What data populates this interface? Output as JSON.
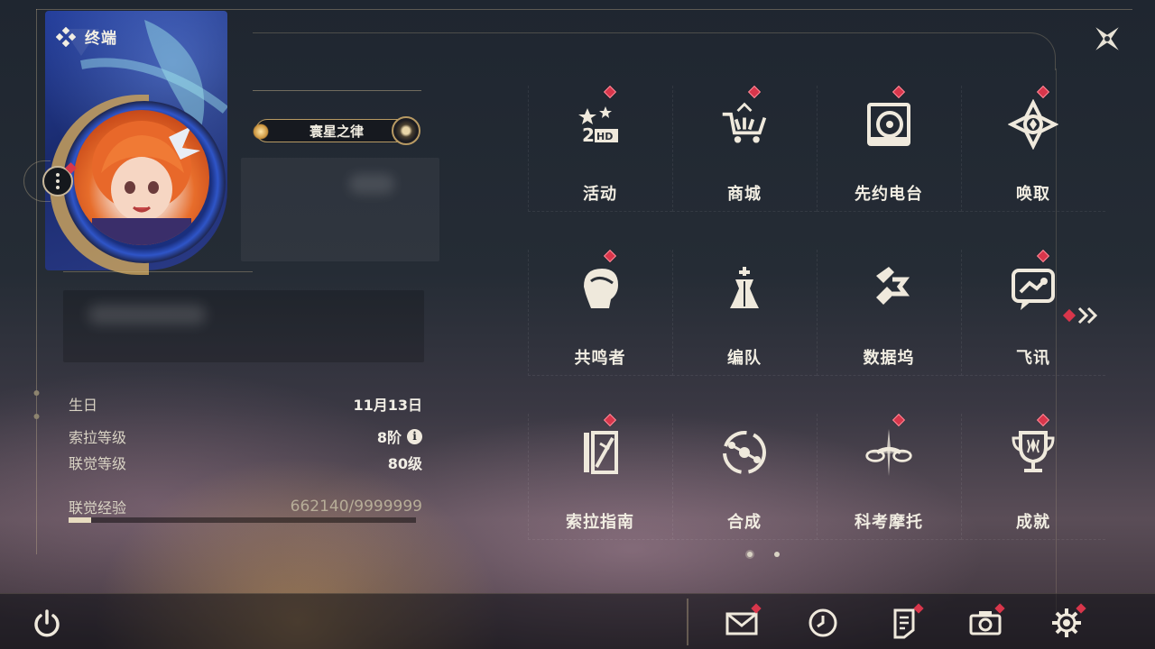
{
  "header": {
    "title": "终端"
  },
  "profile": {
    "title_badge": "寰星之律",
    "stats": [
      {
        "label": "生日",
        "value": "11月13日"
      },
      {
        "label": "索拉等级",
        "value": "8阶"
      },
      {
        "label": "联觉等级",
        "value": "80级"
      }
    ],
    "exp": {
      "label": "联觉经验",
      "value": "662140/9999999",
      "progress_fraction": 0.066
    }
  },
  "menu": {
    "items": [
      {
        "label": "活动",
        "icon": "event-2hd-icon",
        "badge": true
      },
      {
        "label": "商城",
        "icon": "shop-cart-icon",
        "badge": true
      },
      {
        "label": "先约电台",
        "icon": "radio-icon",
        "badge": true
      },
      {
        "label": "唤取",
        "icon": "summon-icon",
        "badge": true
      },
      {
        "label": "共鸣者",
        "icon": "resonator-icon",
        "badge": true
      },
      {
        "label": "编队",
        "icon": "team-chess-icon",
        "badge": false
      },
      {
        "label": "数据坞",
        "icon": "data-dock-icon",
        "badge": false
      },
      {
        "label": "飞讯",
        "icon": "message-icon",
        "badge": true
      },
      {
        "label": "索拉指南",
        "icon": "guide-book-icon",
        "badge": true
      },
      {
        "label": "合成",
        "icon": "synthesis-icon",
        "badge": false
      },
      {
        "label": "科考摩托",
        "icon": "motorcycle-icon",
        "badge": true
      },
      {
        "label": "成就",
        "icon": "trophy-icon",
        "badge": true
      }
    ],
    "pages": 2,
    "current_page": 1
  },
  "bottom_bar": {
    "icons": [
      {
        "name": "mail-icon",
        "badge": true
      },
      {
        "name": "clock-icon",
        "badge": false
      },
      {
        "name": "notice-icon",
        "badge": true
      },
      {
        "name": "camera-icon",
        "badge": true
      },
      {
        "name": "settings-gear-icon",
        "badge": true
      }
    ]
  },
  "colors": {
    "badge": "#d8364b",
    "accent_gold": "#c9a86a",
    "text": "#ece8dc"
  }
}
